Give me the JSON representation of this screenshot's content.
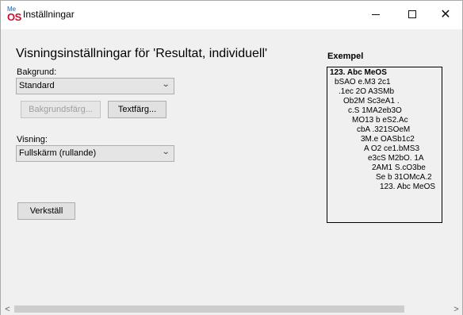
{
  "window": {
    "title": "Inställningar",
    "app_icon": {
      "top": "Me",
      "bottom": "OS"
    },
    "controls": {
      "minimize": "minimize-icon",
      "maximize": "maximize-icon",
      "close": "close-icon"
    }
  },
  "settings": {
    "heading": "Visningsinställningar för 'Resultat, individuell'",
    "background_label": "Bakgrund:",
    "background_value": "Standard",
    "background_color_button": "Bakgrundsfärg...",
    "text_color_button": "Textfärg...",
    "view_label": "Visning:",
    "view_value": "Fullskärm (rullande)",
    "apply_button": "Verkställ"
  },
  "example": {
    "title": "Exempel",
    "lines": [
      "123. Abc MeOS",
      "bSAO e.M3 2c1",
      ".1ec 2O A3SMb",
      "Ob2M Sc3eA1 .",
      "c.S  1MA2eb3O",
      "MO13 b eS2.Ac",
      "cbA .321SOeM",
      "3M.e OASb1c2",
      "A O2 ce1.bMS3",
      "e3cS M2bO. 1A",
      "2AM1  S.cO3be",
      "Se b 31OMcA.2",
      "123. Abc MeOS"
    ]
  },
  "scrollbar": {
    "left_arrow": "<",
    "right_arrow": ">"
  }
}
